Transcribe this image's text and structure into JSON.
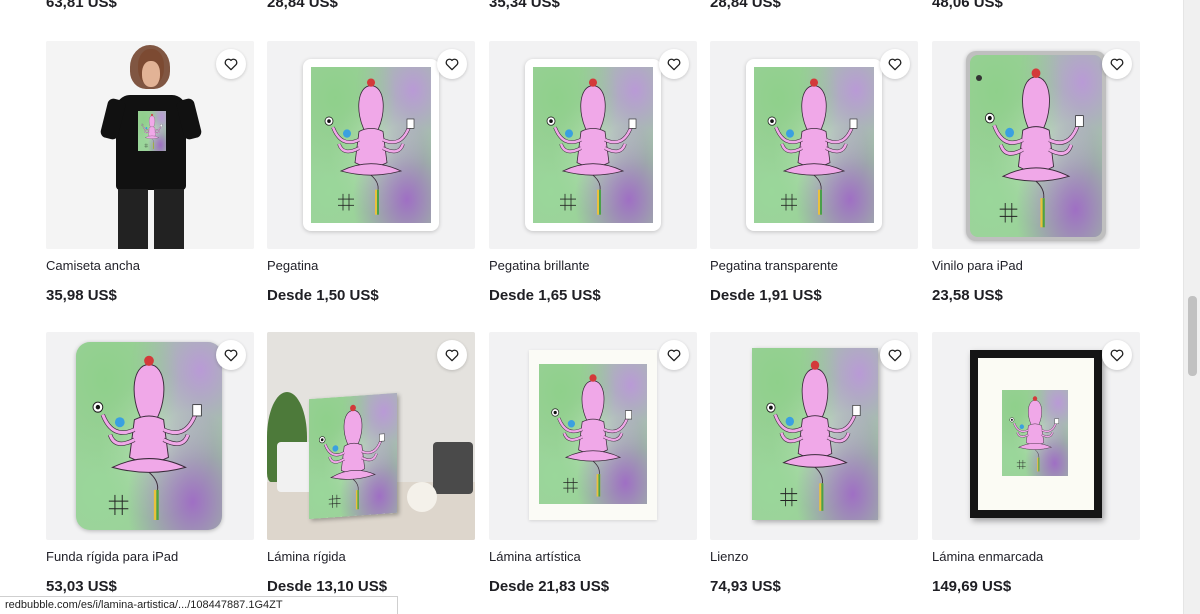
{
  "top_row_prices": [
    "63,81 US$",
    "28,84 US$",
    "35,34 US$",
    "28,84 US$",
    "48,06 US$"
  ],
  "products": [
    {
      "title": "Camiseta ancha",
      "price": "35,98 US$",
      "mockup": "tshirt"
    },
    {
      "title": "Pegatina",
      "price": "Desde 1,50 US$",
      "mockup": "sticker"
    },
    {
      "title": "Pegatina brillante",
      "price": "Desde 1,65 US$",
      "mockup": "sticker"
    },
    {
      "title": "Pegatina transparente",
      "price": "Desde 1,91 US$",
      "mockup": "sticker"
    },
    {
      "title": "Vinilo para iPad",
      "price": "23,58 US$",
      "mockup": "ipad-skin"
    },
    {
      "title": "Funda rígida para iPad",
      "price": "53,03 US$",
      "mockup": "ipad-case"
    },
    {
      "title": "Lámina rígida",
      "price": "Desde 13,10 US$",
      "mockup": "board"
    },
    {
      "title": "Lámina artística",
      "price": "Desde 21,83 US$",
      "mockup": "art-print"
    },
    {
      "title": "Lienzo",
      "price": "74,93 US$",
      "mockup": "canvas"
    },
    {
      "title": "Lámina enmarcada",
      "price": "149,69 US$",
      "mockup": "framed"
    }
  ],
  "icons": {
    "favorite": "heart-icon"
  },
  "status_bar": {
    "url": "redbubble.com/es/i/lamina-artistica/.../108447887.1G4ZT"
  },
  "colors": {
    "text": "#1f1f24",
    "thumb_bg": "#f2f2f3",
    "art_green": "#9ccf9a",
    "art_purple": "#9f6fc4",
    "figure_pink": "#f0a8e8"
  }
}
